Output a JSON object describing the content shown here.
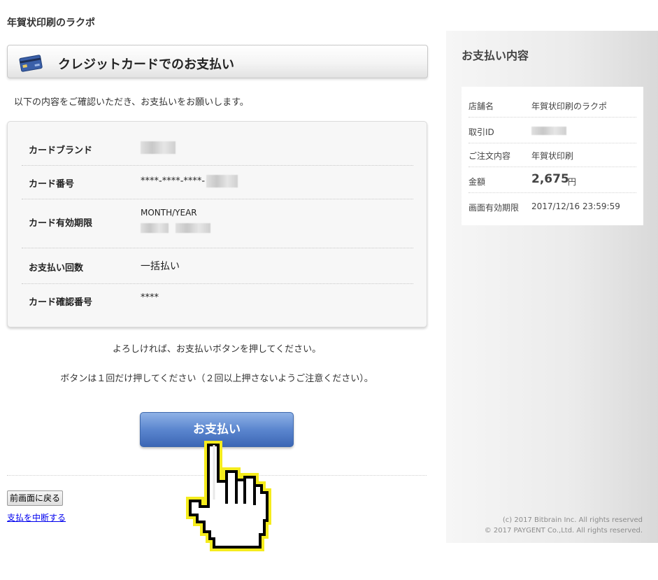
{
  "shop_name": "年賀状印刷のラクポ",
  "header": {
    "title": "クレジットカードでのお支払い",
    "icon": "credit-card-icon"
  },
  "intro_text": "以下の内容をご確認いただき、お支払いをお願いします。",
  "card_info": {
    "brand_label": "カードブランド",
    "number_label": "カード番号",
    "number_value": "****-****-****-",
    "expiry_label": "カード有効期限",
    "expiry_format": "MONTH/YEAR",
    "installments_label": "お支払い回数",
    "installments_value": "一括払い",
    "cvv_label": "カード確認番号",
    "cvv_value": "****"
  },
  "confirm_text_1": "よろしければ、お支払いボタンを押してください。",
  "confirm_text_2": "ボタンは１回だけ押してください（２回以上押さないようご注意ください）。",
  "pay_button_label": "お支払い",
  "back_button_label": "前画面に戻る",
  "cancel_link_label": "支払を中断する",
  "sidebar": {
    "title": "お支払い内容",
    "store_label": "店舗名",
    "store_value": "年賀状印刷のラクポ",
    "transaction_label": "取引ID",
    "order_label": "ご注文内容",
    "order_value": "年賀状印刷",
    "amount_label": "金額",
    "amount_value": "2,675",
    "amount_unit": "円",
    "expiry_label": "画面有効期限",
    "expiry_value": "2017/12/16 23:59:59",
    "copyright_1": "(c) 2017 Bitbrain Inc. All rights reserved",
    "copyright_2": "© 2017 PAYGENT Co.,Ltd. All rights reserved."
  },
  "colors": {
    "pay_button": "#5b86cf",
    "link": "#0000ee",
    "hand_outline": "#f5ec1d"
  }
}
